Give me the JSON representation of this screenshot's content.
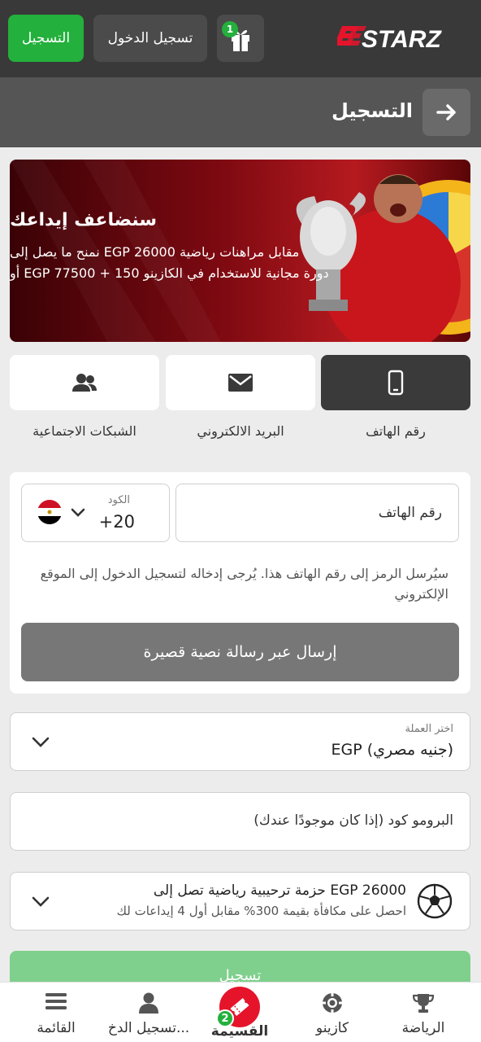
{
  "header": {
    "register_label": "التسجيل",
    "login_label": "تسجيل الدخول",
    "gift_count": "1",
    "logo_text": "STARZ",
    "brand_color": "#e5142b",
    "accent_color": "#23b03c"
  },
  "subheader": {
    "title": "التسجيل",
    "back_icon": "arrow-right-icon"
  },
  "banner": {
    "title": "سنضاعف إيداعك",
    "line1": "نمنح ما يصل إلى EGP 26000 مقابل مراهنات رياضية",
    "line2": "أو EGP 77500 + 150 دورة مجانية للاستخدام في الكازينو"
  },
  "methods": [
    {
      "label": "رقم الهاتف",
      "icon": "phone-icon",
      "active": true
    },
    {
      "label": "البريد الالكتروني",
      "icon": "envelope-icon",
      "active": false
    },
    {
      "label": "الشبكات الاجتماعية",
      "icon": "users-icon",
      "active": false
    }
  ],
  "phone_form": {
    "code_label": "الكود",
    "code_value": "+20",
    "country_flag": "egypt-flag-icon",
    "phone_placeholder": "رقم الهاتف",
    "note": "سيُرسل الرمز إلى رقم الهاتف هذا. يُرجى إدخاله لتسجيل الدخول إلى الموقع الإلكتروني",
    "sms_button": "إرسال عبر رسالة نصية قصيرة"
  },
  "currency": {
    "label": "اختر العملة",
    "value": "EGP (جنيه مصري)"
  },
  "promo": {
    "placeholder": "البرومو كود (إذا كان موجودًا عندك)"
  },
  "bonus": {
    "title": "حزمة ترحيبية رياضية تصل إلى EGP 26000",
    "subtitle": "احصل على مكافأة بقيمة 300% مقابل أول 4 إيداعات لك",
    "icon": "soccer-ball-icon"
  },
  "submit_label": "تسجيل",
  "bottom_nav": {
    "items": [
      {
        "label": "القائمة",
        "icon": "menu-icon"
      },
      {
        "label": "تسجيل الدخ...",
        "icon": "user-icon"
      },
      {
        "label": "القسيمة",
        "icon": "ticket-icon",
        "badge": "2"
      },
      {
        "label": "كازينو",
        "icon": "casino-chip-icon"
      },
      {
        "label": "الرياضة",
        "icon": "trophy-icon"
      }
    ]
  }
}
